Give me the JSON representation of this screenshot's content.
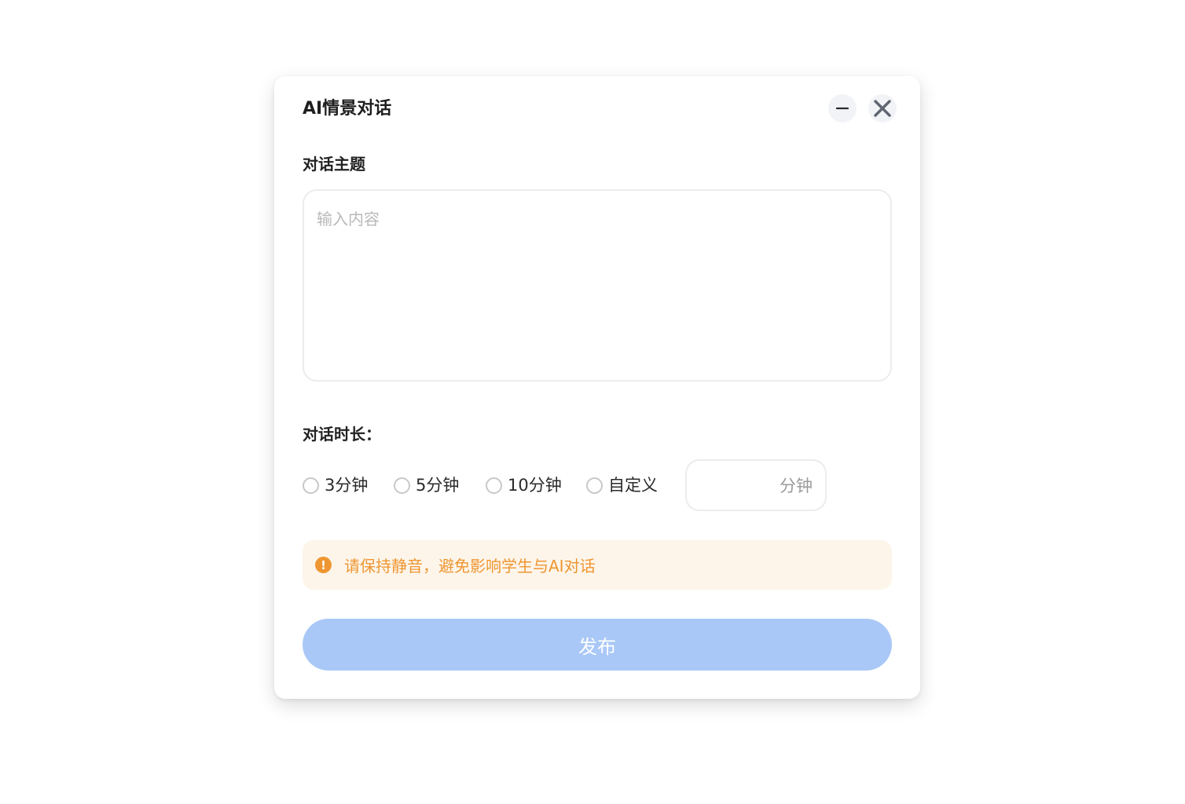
{
  "dialog": {
    "title": "AI情景对话",
    "minimize_icon": "minus-icon",
    "close_icon": "close-icon"
  },
  "topic": {
    "label": "对话主题",
    "placeholder": "输入内容",
    "value": ""
  },
  "duration": {
    "label": "对话时长：",
    "options": [
      {
        "label": "3分钟",
        "selected": false
      },
      {
        "label": "5分钟",
        "selected": false
      },
      {
        "label": "10分钟",
        "selected": false
      },
      {
        "label": "自定义",
        "selected": false
      }
    ],
    "custom_value": "",
    "custom_unit": "分钟"
  },
  "notice": {
    "icon": "exclamation-circle-icon",
    "text": "请保持静音，避免影响学生与AI对话",
    "color": "#ee9631",
    "background": "#fdf5ea"
  },
  "publish": {
    "label": "发布",
    "background": "#a9c8f7"
  }
}
